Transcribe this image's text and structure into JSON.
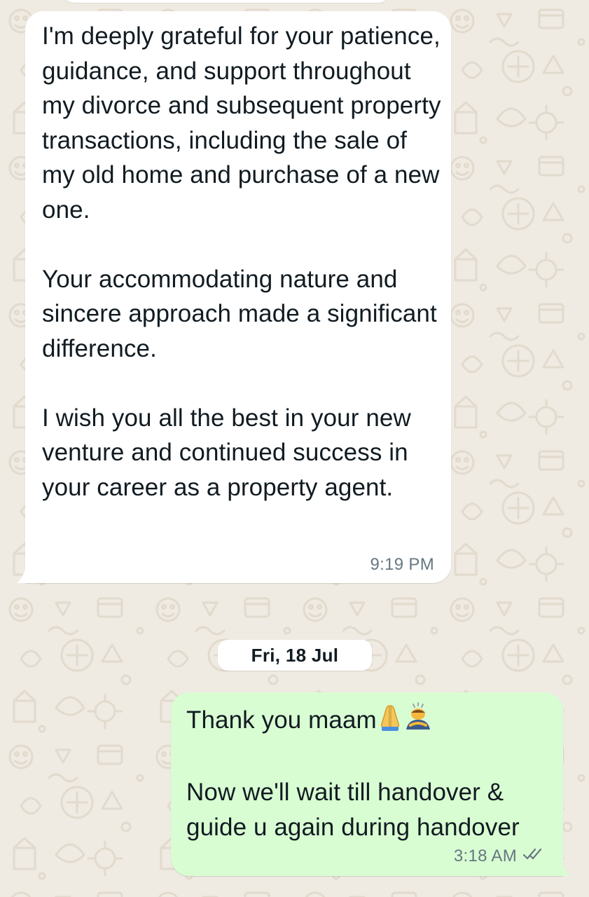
{
  "chat": {
    "messages": [
      {
        "direction": "incoming",
        "text": "I'm deeply grateful for your patience, guidance, and support throughout my divorce and subsequent property transactions, including the sale of my old home and purchase of a new one.\n\nYour accommodating nature and sincere approach made a significant difference.\n\nI wish you all the best in your new venture and continued success in your career as a property agent.",
        "time": "9:19 PM"
      },
      {
        "direction": "outgoing",
        "text_line_1": "Thank you maam",
        "text_rest": "\n\nNow we'll wait till handover & guide u again during handover",
        "emojis": [
          "folded-hands-emoji",
          "person-bowing-emoji"
        ],
        "time": "3:18 AM",
        "status_icon": "double-check-icon"
      }
    ],
    "date_separator": "Fri, 18 Jul"
  },
  "colors": {
    "wallpaper": "#efeae2",
    "incoming_bubble": "#ffffff",
    "outgoing_bubble": "#d9fdd3",
    "meta_text": "#667781",
    "text": "#111b21"
  }
}
